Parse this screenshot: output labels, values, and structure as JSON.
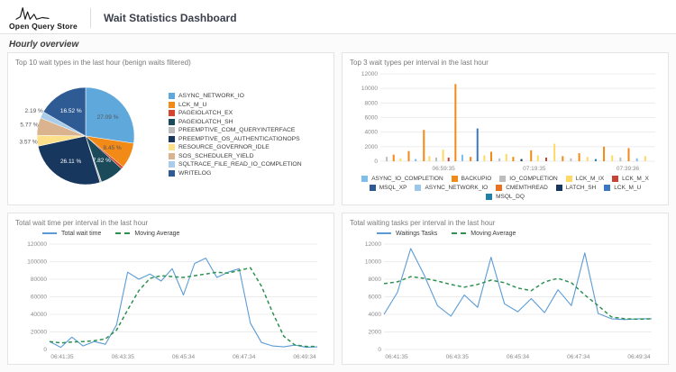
{
  "header": {
    "logo_text": "Open Query Store",
    "title": "Wait Statistics Dashboard"
  },
  "section_title": "Hourly overview",
  "colors": {
    "line_blue": "#5B9BD5",
    "line_green": "#2E9151",
    "grid": "#ececec",
    "axis_text": "#8a8a8a"
  },
  "chart_data": [
    {
      "type": "pie",
      "title": "Top 10 wait types in the last hour (benign waits filtered)",
      "legend_position": "right",
      "slices": [
        {
          "label": "ASYNC_NETWORK_IO",
          "value": 27.09,
          "color": "#5FA8DC"
        },
        {
          "label": "LCK_M_U",
          "value": 8.45,
          "color": "#F28A18"
        },
        {
          "label": "PAGEIOLATCH_EX",
          "value": 0.82,
          "color": "#D64532"
        },
        {
          "label": "PAGEIOLATCH_SH",
          "value": 7.82,
          "color": "#1B4A5A"
        },
        {
          "label": "PREEMPTIVE_COM_QUERYINTERFACE",
          "value": 0.53,
          "color": "#BDBDBD"
        },
        {
          "label": "PREEMPTIVE_OS_AUTHENTICATIONOPS",
          "value": 26.11,
          "color": "#17375E"
        },
        {
          "label": "RESOURCE_GOVERNOR_IDLE",
          "value": 3.57,
          "color": "#FFE08A"
        },
        {
          "label": "SOS_SCHEDULER_YIELD",
          "value": 5.77,
          "color": "#D9B48F"
        },
        {
          "label": "SQLTRACE_FILE_READ_IO_COMPLETION",
          "value": 2.19,
          "color": "#A8CCEA"
        },
        {
          "label": "WRITELOG",
          "value": 16.52,
          "color": "#2F5B94"
        }
      ]
    },
    {
      "type": "bar",
      "title": "Top 3 wait types per interval in the last hour",
      "ylim": [
        0,
        12000
      ],
      "ytick_step": 2000,
      "x_ticks": [
        {
          "label": "06:59:35",
          "p": 0.23
        },
        {
          "label": "07:19:35",
          "p": 0.56
        },
        {
          "label": "07:39:36",
          "p": 0.9
        }
      ],
      "legend": [
        {
          "label": "ASYNC_IO_COMPLETION",
          "color": "#7FBEEB"
        },
        {
          "label": "BACKUPIO",
          "color": "#F28A18"
        },
        {
          "label": "IO_COMPLETION",
          "color": "#BDBDBD"
        },
        {
          "label": "LCK_M_IX",
          "color": "#FFD966"
        },
        {
          "label": "LCK_M_X",
          "color": "#C44536"
        },
        {
          "label": "MSQL_XP",
          "color": "#2F5B94"
        },
        {
          "label": "ASYNC_NETWORK_IO",
          "color": "#9CC7E8"
        },
        {
          "label": "CMEMTHREAD",
          "color": "#E8731F"
        },
        {
          "label": "LATCH_SH",
          "color": "#17375E"
        },
        {
          "label": "LCK_M_U",
          "color": "#3B78C3"
        },
        {
          "label": "MSQL_DQ",
          "color": "#2180A8"
        }
      ],
      "bars": [
        {
          "p": 0.02,
          "v": 600,
          "color": "#BDBDBD"
        },
        {
          "p": 0.045,
          "v": 900,
          "color": "#F28A18"
        },
        {
          "p": 0.07,
          "v": 400,
          "color": "#FFD966"
        },
        {
          "p": 0.1,
          "v": 1400,
          "color": "#F28A18"
        },
        {
          "p": 0.125,
          "v": 300,
          "color": "#7FBEEB"
        },
        {
          "p": 0.155,
          "v": 4300,
          "color": "#F28A18"
        },
        {
          "p": 0.175,
          "v": 700,
          "color": "#FFD966"
        },
        {
          "p": 0.2,
          "v": 500,
          "color": "#BDBDBD"
        },
        {
          "p": 0.225,
          "v": 1600,
          "color": "#FFD966"
        },
        {
          "p": 0.245,
          "v": 500,
          "color": "#C44536"
        },
        {
          "p": 0.27,
          "v": 10600,
          "color": "#F28A18"
        },
        {
          "p": 0.295,
          "v": 900,
          "color": "#7FBEEB"
        },
        {
          "p": 0.325,
          "v": 600,
          "color": "#F28A18"
        },
        {
          "p": 0.35,
          "v": 4500,
          "color": "#3B78C3"
        },
        {
          "p": 0.375,
          "v": 800,
          "color": "#FFD966"
        },
        {
          "p": 0.4,
          "v": 1300,
          "color": "#F28A18"
        },
        {
          "p": 0.43,
          "v": 400,
          "color": "#BDBDBD"
        },
        {
          "p": 0.455,
          "v": 1000,
          "color": "#FFD966"
        },
        {
          "p": 0.48,
          "v": 600,
          "color": "#F28A18"
        },
        {
          "p": 0.51,
          "v": 300,
          "color": "#17375E"
        },
        {
          "p": 0.545,
          "v": 1500,
          "color": "#F28A18"
        },
        {
          "p": 0.57,
          "v": 800,
          "color": "#FFD966"
        },
        {
          "p": 0.6,
          "v": 500,
          "color": "#C44536"
        },
        {
          "p": 0.63,
          "v": 2400,
          "color": "#FFD966"
        },
        {
          "p": 0.66,
          "v": 700,
          "color": "#F28A18"
        },
        {
          "p": 0.69,
          "v": 400,
          "color": "#BDBDBD"
        },
        {
          "p": 0.72,
          "v": 1100,
          "color": "#F28A18"
        },
        {
          "p": 0.75,
          "v": 600,
          "color": "#FFD966"
        },
        {
          "p": 0.78,
          "v": 300,
          "color": "#2180A8"
        },
        {
          "p": 0.81,
          "v": 2000,
          "color": "#F28A18"
        },
        {
          "p": 0.84,
          "v": 800,
          "color": "#FFD966"
        },
        {
          "p": 0.87,
          "v": 500,
          "color": "#BDBDBD"
        },
        {
          "p": 0.9,
          "v": 1800,
          "color": "#F28A18"
        },
        {
          "p": 0.93,
          "v": 400,
          "color": "#7FBEEB"
        },
        {
          "p": 0.96,
          "v": 700,
          "color": "#FFD966"
        }
      ]
    },
    {
      "type": "line",
      "title": "Total wait time per interval in the last hour",
      "ylim": [
        0,
        120000
      ],
      "ytick_step": 20000,
      "x_labels": [
        "06:41:35",
        "06:43:35",
        "06:45:34",
        "06:47:34",
        "06:49:34"
      ],
      "series": [
        {
          "name": "Total wait time",
          "color": "#5B9BD5",
          "dash": "",
          "values": [
            9000,
            2500,
            14000,
            4000,
            9000,
            6000,
            28000,
            88000,
            80000,
            86000,
            78000,
            92000,
            62000,
            98000,
            104000,
            82000,
            88000,
            92000,
            30000,
            8000,
            4000,
            3000,
            5000,
            2500,
            3000
          ]
        },
        {
          "name": "Moving Average",
          "color": "#2E9151",
          "dash": "4 3",
          "values": [
            9000,
            7500,
            8500,
            9000,
            10000,
            12000,
            22000,
            45000,
            67000,
            81000,
            84000,
            83000,
            82000,
            84000,
            86000,
            88000,
            87000,
            90000,
            93000,
            72000,
            42000,
            15000,
            5000,
            3500,
            3500
          ]
        }
      ]
    },
    {
      "type": "line",
      "title": "Total waiting tasks per interval in the last hour",
      "ylim": [
        0,
        12000
      ],
      "ytick_step": 2000,
      "x_labels": [
        "06:41:35",
        "06:43:35",
        "06:45:34",
        "06:47:34",
        "06:49:34"
      ],
      "series": [
        {
          "name": "Waitings Tasks",
          "color": "#5B9BD5",
          "dash": "",
          "values": [
            4000,
            6500,
            11500,
            8500,
            5000,
            3800,
            6200,
            4800,
            10500,
            5200,
            4300,
            5800,
            4200,
            6800,
            5000,
            11000,
            4100,
            3500,
            3400,
            3500,
            3500
          ]
        },
        {
          "name": "Moving Average",
          "color": "#2E9151",
          "dash": "4 3",
          "values": [
            7500,
            7700,
            8300,
            8100,
            7800,
            7400,
            7100,
            7400,
            7900,
            7600,
            7000,
            6700,
            7700,
            8100,
            7600,
            6200,
            5000,
            3700,
            3500,
            3450,
            3500
          ]
        }
      ]
    }
  ]
}
